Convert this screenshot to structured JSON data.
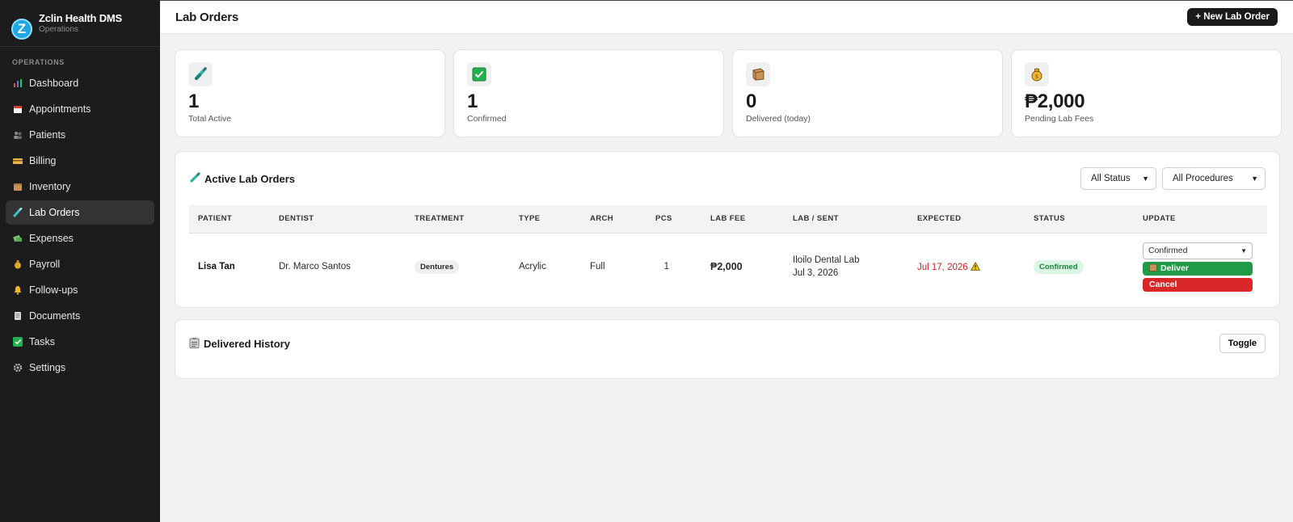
{
  "brand": {
    "name": "Zclin Health DMS",
    "subtitle": "Operations",
    "logo_letter": "Z"
  },
  "sidebar": {
    "section": "OPERATIONS",
    "items": [
      {
        "label": "Dashboard",
        "icon": "chart-icon"
      },
      {
        "label": "Appointments",
        "icon": "calendar-icon"
      },
      {
        "label": "Patients",
        "icon": "people-icon"
      },
      {
        "label": "Billing",
        "icon": "card-icon"
      },
      {
        "label": "Inventory",
        "icon": "box-icon"
      },
      {
        "label": "Lab Orders",
        "icon": "test-tube-icon",
        "active": true
      },
      {
        "label": "Expenses",
        "icon": "money-icon"
      },
      {
        "label": "Payroll",
        "icon": "money-bag-icon"
      },
      {
        "label": "Follow-ups",
        "icon": "bell-icon"
      },
      {
        "label": "Documents",
        "icon": "document-icon"
      },
      {
        "label": "Tasks",
        "icon": "check-icon"
      },
      {
        "label": "Settings",
        "icon": "gear-icon"
      }
    ]
  },
  "header": {
    "title": "Lab Orders",
    "new_button": "+ New Lab Order"
  },
  "stats": [
    {
      "value": "1",
      "label": "Total Active",
      "icon": "test-tube-icon"
    },
    {
      "value": "1",
      "label": "Confirmed",
      "icon": "check-icon"
    },
    {
      "value": "0",
      "label": "Delivered (today)",
      "icon": "box-icon"
    },
    {
      "value": "₱2,000",
      "label": "Pending Lab Fees",
      "icon": "money-bag-icon"
    }
  ],
  "active_orders": {
    "title": "Active Lab Orders",
    "filter_status": "All Status",
    "filter_procedures": "All Procedures",
    "columns": [
      "PATIENT",
      "DENTIST",
      "TREATMENT",
      "TYPE",
      "ARCH",
      "PCS",
      "LAB FEE",
      "LAB / SENT",
      "EXPECTED",
      "STATUS",
      "UPDATE"
    ],
    "rows": [
      {
        "patient": "Lisa Tan",
        "dentist": "Dr. Marco Santos",
        "treatment": "Dentures",
        "type": "Acrylic",
        "arch": "Full",
        "pcs": "1",
        "lab_fee": "₱2,000",
        "lab": "Iloilo Dental Lab",
        "sent": "Jul 3, 2026",
        "expected": "Jul 17, 2026",
        "status": "Confirmed",
        "update_value": "Confirmed",
        "deliver_label": "Deliver",
        "cancel_label": "Cancel"
      }
    ]
  },
  "history": {
    "title": "Delivered History",
    "toggle_label": "Toggle"
  },
  "colors": {
    "sidebar_bg": "#1c1c1c",
    "deliver": "#1f9a45",
    "cancel": "#d92626",
    "status_confirmed": "#148a3c",
    "expected_overdue": "#d02020"
  }
}
